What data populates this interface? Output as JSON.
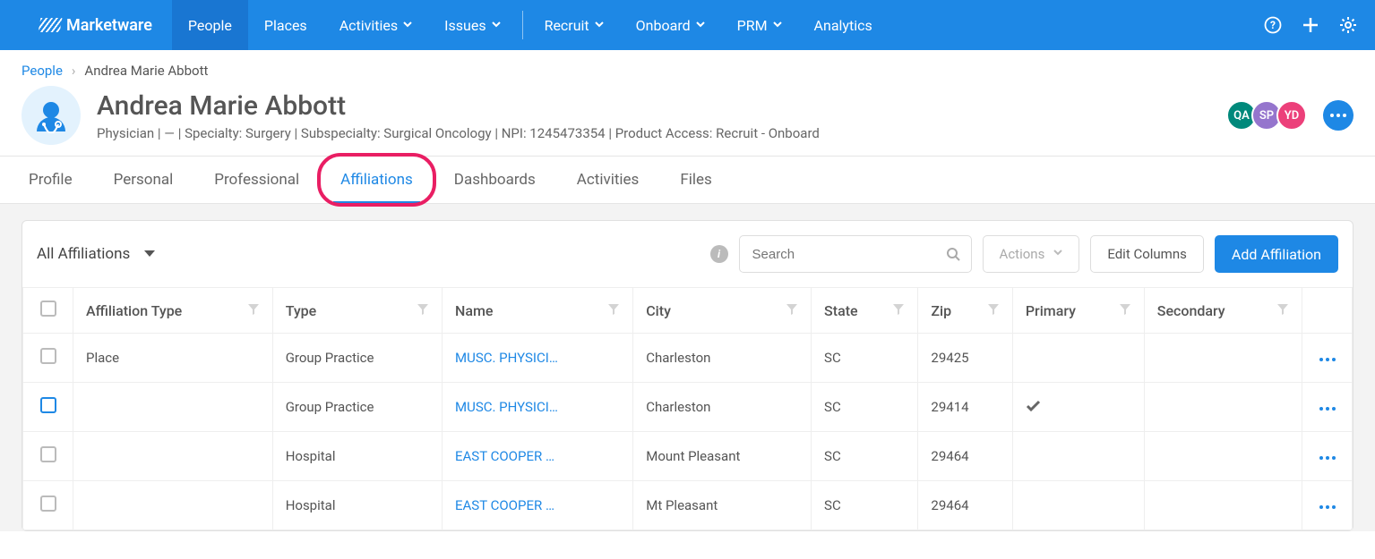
{
  "brand": "Marketware",
  "nav": {
    "items": [
      {
        "label": "People",
        "active": true,
        "caret": false
      },
      {
        "label": "Places",
        "caret": false
      },
      {
        "label": "Activities",
        "caret": true
      },
      {
        "label": "Issues",
        "caret": true
      },
      {
        "sep": true
      },
      {
        "label": "Recruit",
        "caret": true
      },
      {
        "label": "Onboard",
        "caret": true
      },
      {
        "label": "PRM",
        "caret": true
      },
      {
        "label": "Analytics",
        "caret": false
      }
    ]
  },
  "breadcrumb": {
    "root": "People",
    "current": "Andrea Marie Abbott"
  },
  "header": {
    "name": "Andrea Marie Abbott",
    "subtitle": "Physician | — | Specialty: Surgery | Subspecialty: Surgical Oncology | NPI: 1245473354 | Product Access: Recruit - Onboard",
    "chips": [
      {
        "text": "QA",
        "color": "#00897b"
      },
      {
        "text": "SP",
        "color": "#9575cd"
      },
      {
        "text": "YD",
        "color": "#ec407a"
      }
    ]
  },
  "tabs": [
    {
      "label": "Profile"
    },
    {
      "label": "Personal"
    },
    {
      "label": "Professional"
    },
    {
      "label": "Affiliations",
      "active": true,
      "highlight": true
    },
    {
      "label": "Dashboards"
    },
    {
      "label": "Activities"
    },
    {
      "label": "Files"
    }
  ],
  "toolbar": {
    "filter_label": "All Affiliations",
    "search_placeholder": "Search",
    "actions_label": "Actions",
    "edit_columns_label": "Edit Columns",
    "add_label": "Add Affiliation"
  },
  "columns": [
    "Affiliation Type",
    "Type",
    "Name",
    "City",
    "State",
    "Zip",
    "Primary",
    "Secondary"
  ],
  "rows": [
    {
      "aff_type": "Place",
      "type": "Group Practice",
      "name": "MUSC. PHYSICI…",
      "city": "Charleston",
      "state": "SC",
      "zip": "29425",
      "primary": false,
      "secondary": false,
      "check_hollow": false
    },
    {
      "aff_type": "",
      "type": "Group Practice",
      "name": "MUSC. PHYSICI…",
      "city": "Charleston",
      "state": "SC",
      "zip": "29414",
      "primary": true,
      "secondary": false,
      "check_hollow": true
    },
    {
      "aff_type": "",
      "type": "Hospital",
      "name": "EAST COOPER …",
      "city": "Mount Pleasant",
      "state": "SC",
      "zip": "29464",
      "primary": false,
      "secondary": false,
      "check_hollow": false
    },
    {
      "aff_type": "",
      "type": "Hospital",
      "name": "EAST COOPER …",
      "city": "Mt Pleasant",
      "state": "SC",
      "zip": "29464",
      "primary": false,
      "secondary": false,
      "check_hollow": false
    }
  ]
}
